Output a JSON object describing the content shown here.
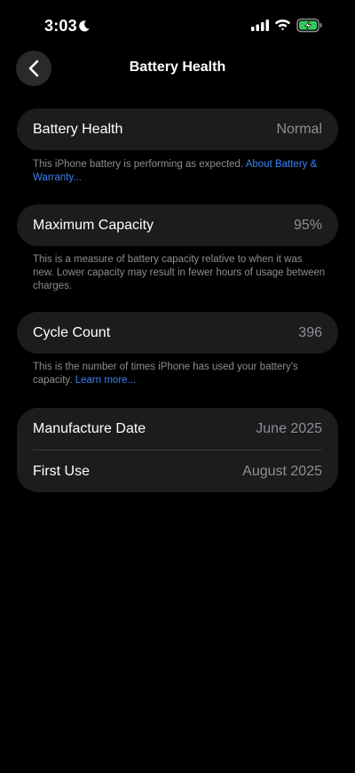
{
  "status_bar": {
    "time": "3:03",
    "icons": [
      "moon-icon",
      "cellular-signal-icon",
      "wifi-icon",
      "battery-charging-icon"
    ],
    "battery_color": "#34c759"
  },
  "nav": {
    "back_icon": "chevron-left-icon",
    "title": "Battery Health"
  },
  "sections": {
    "battery_health": {
      "label": "Battery Health",
      "value": "Normal",
      "footnote": "This iPhone battery is performing as expected. ",
      "link": "About Battery & Warranty..."
    },
    "maximum_capacity": {
      "label": "Maximum Capacity",
      "value": "95%",
      "footnote": "This is a measure of battery capacity relative to when it was new. Lower capacity may result in fewer hours of usage between charges."
    },
    "cycle_count": {
      "label": "Cycle Count",
      "value": "396",
      "footnote": "This is the number of times iPhone has used your battery's capacity. ",
      "link": "Learn more..."
    },
    "dates": {
      "manufacture_label": "Manufacture Date",
      "manufacture_value": "June 2025",
      "first_use_label": "First Use",
      "first_use_value": "August 2025"
    }
  },
  "colors": {
    "background": "#000000",
    "card": "#1c1c1e",
    "secondary_text": "#8e8e93",
    "link": "#3b82f6"
  }
}
